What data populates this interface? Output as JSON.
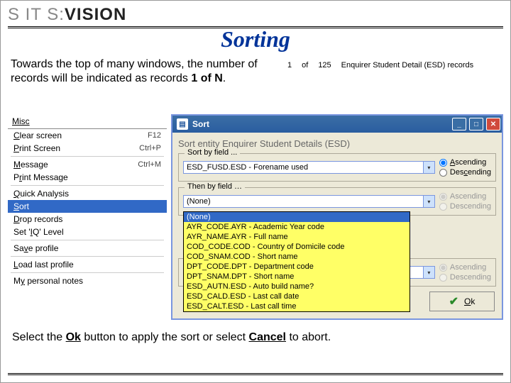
{
  "logo": {
    "part1": "S IT S:",
    "part2": "VISION"
  },
  "title": "Sorting",
  "intro": {
    "pre": "Towards the top of many windows, the number of records will be indicated as records ",
    "bold": "1 of N",
    "post": "."
  },
  "recbanner": {
    "cur": "1",
    "of": "of",
    "total": "125",
    "label": "Enquirer Student Detail (ESD) records"
  },
  "menu": {
    "head": "Misc",
    "items": [
      {
        "u": "C",
        "rest": "lear screen",
        "hotkey": "F12"
      },
      {
        "u": "P",
        "rest": "rint Screen",
        "hotkey": "Ctrl+P"
      }
    ],
    "items2": [
      {
        "pre": "",
        "u": "M",
        "rest": "essage",
        "hotkey": "Ctrl+M"
      },
      {
        "pre": "P",
        "u": "r",
        "rest": "int Message",
        "hotkey": ""
      }
    ],
    "items3": [
      {
        "u": "Q",
        "rest": "uick Analysis",
        "hotkey": ""
      },
      {
        "u": "S",
        "rest": "ort",
        "hotkey": "",
        "selected": true
      },
      {
        "u": "D",
        "rest": "rop records",
        "hotkey": ""
      },
      {
        "pre": "Set '",
        "u": "I",
        "rest": "Q' Level",
        "hotkey": ""
      }
    ],
    "items4": [
      {
        "pre": "Sa",
        "u": "v",
        "rest": "e profile",
        "hotkey": ""
      }
    ],
    "items5": [
      {
        "u": "L",
        "rest": "oad last profile",
        "hotkey": ""
      }
    ],
    "items6": [
      {
        "pre": "M",
        "u": "y",
        "rest": " personal notes",
        "hotkey": ""
      }
    ]
  },
  "sortwin": {
    "title": "Sort",
    "subtitle": "Sort entity Enquirer Student Details (ESD)",
    "group1": {
      "legend": "Sort by field ...",
      "combo": "ESD_FUSD.ESD - Forename used",
      "asc": "Ascending",
      "desc": "Descending",
      "sel": "asc"
    },
    "group2": {
      "legend": "Then by field …",
      "combo": "(None)",
      "asc": "Ascending",
      "desc": "Descending",
      "options": [
        "(None)",
        "AYR_CODE.AYR - Academic Year code",
        "AYR_NAME.AYR - Full name",
        "COD_CODE.COD - Country of Domicile code",
        "COD_SNAM.COD - Short name",
        "DPT_CODE.DPT - Department code",
        "DPT_SNAM.DPT - Short name",
        "ESD_AUTN.ESD - Auto build name?",
        "ESD_CALD.ESD - Last call date",
        "ESD_CALT.ESD - Last call time"
      ]
    },
    "group3": {
      "asc": "Ascending",
      "desc": "Descending"
    },
    "ok": "Ok"
  },
  "bottom": {
    "pre": "Select the ",
    "ok": "Ok",
    "mid": " button to apply the sort or select ",
    "cancel": "Cancel",
    "post": " to abort."
  }
}
